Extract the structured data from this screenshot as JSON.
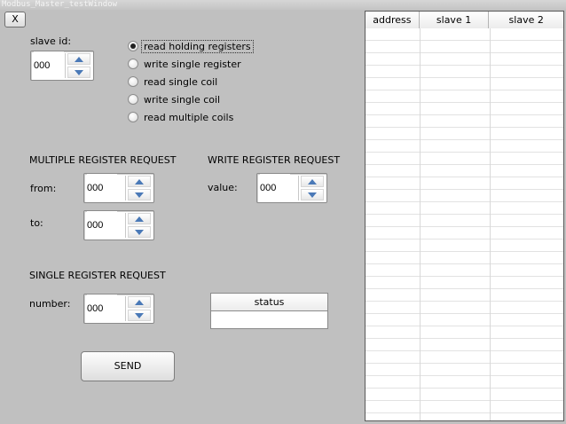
{
  "window": {
    "title": "Modbus_Master_testWindow",
    "close_label": "X"
  },
  "slave_id": {
    "label": "slave id:",
    "value": "000"
  },
  "modes": [
    {
      "label": "read holding registers",
      "checked": true
    },
    {
      "label": "write single register",
      "checked": false
    },
    {
      "label": "read single coil",
      "checked": false
    },
    {
      "label": "write single coil",
      "checked": false
    },
    {
      "label": "read multiple coils",
      "checked": false
    }
  ],
  "multiple_register": {
    "heading": "MULTIPLE REGISTER REQUEST",
    "from_label": "from:",
    "from_value": "000",
    "to_label": "to:",
    "to_value": "000"
  },
  "write_register": {
    "heading": "WRITE REGISTER REQUEST",
    "value_label": "value:",
    "value": "000"
  },
  "single_register": {
    "heading": "SINGLE REGISTER REQUEST",
    "number_label": "number:",
    "number_value": "000"
  },
  "status": {
    "header": "status",
    "value": ""
  },
  "send_label": "SEND",
  "table": {
    "columns": [
      "address",
      "slave 1",
      "slave 2"
    ]
  }
}
